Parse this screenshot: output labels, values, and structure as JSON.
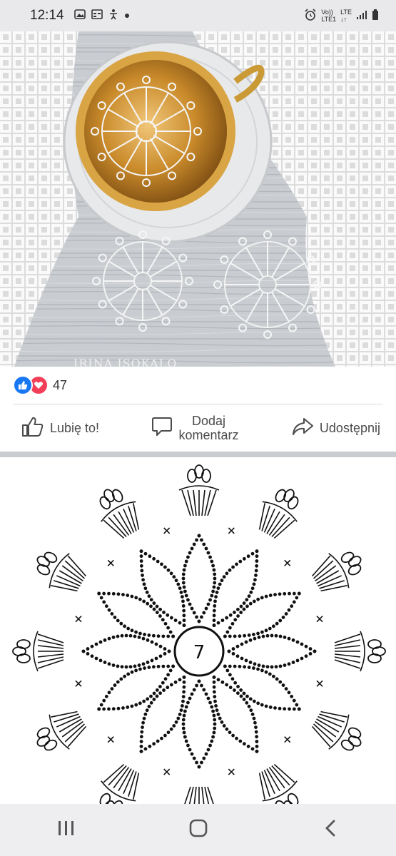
{
  "status_bar": {
    "time": "12:14",
    "network_top": "Vo))",
    "network_bottom": "LTE1",
    "lte_label": "LTE",
    "icons": [
      "photo-icon",
      "calendar-icon",
      "accessibility-icon",
      "dot-icon",
      "alarm-icon",
      "signal-icon",
      "battery-icon"
    ]
  },
  "post_photo": {
    "watermark": "IRINA ISOKALO"
  },
  "reactions": {
    "count": "47",
    "types": [
      "like",
      "love"
    ]
  },
  "actions": {
    "like": "Lubię to!",
    "comment_line1": "Dodaj",
    "comment_line2": "komentarz",
    "share": "Udostępnij"
  },
  "diagram": {
    "center_label": "7"
  },
  "colors": {
    "facebook_blue": "#1877f2",
    "love_red": "#f33e58",
    "status_bg": "#e9e9eb",
    "nav_bg": "#eeeef0"
  }
}
